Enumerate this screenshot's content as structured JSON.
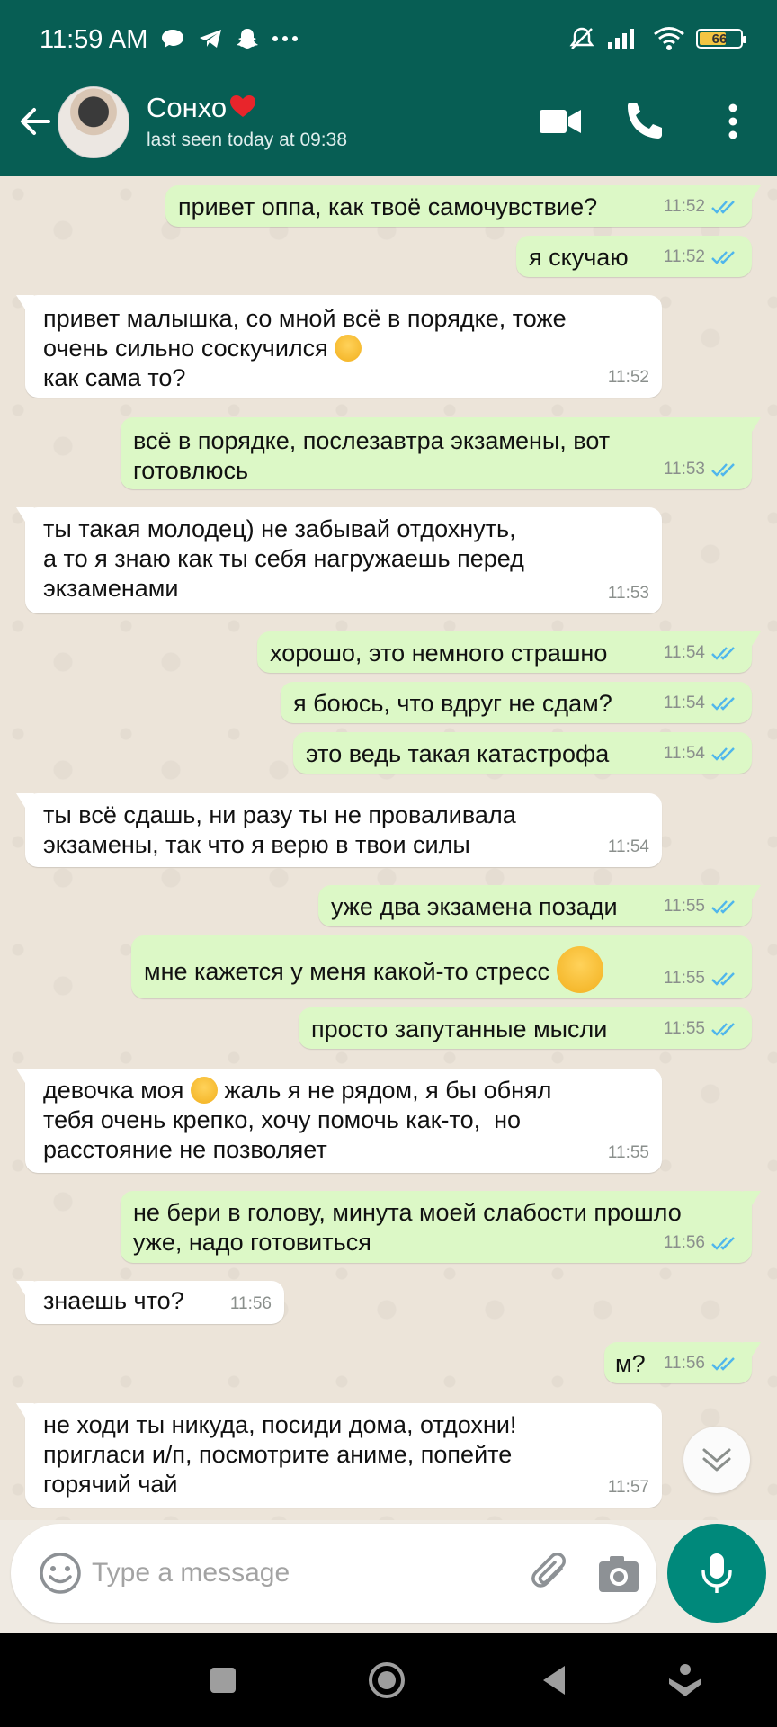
{
  "status_bar": {
    "time": "11:59 AM",
    "battery": "66",
    "icons": [
      "chat-bubble-icon",
      "telegram-icon",
      "snapchat-icon",
      "more-dots-icon",
      "muted-bell-icon",
      "signal-icon",
      "wifi-icon",
      "battery-icon"
    ]
  },
  "header": {
    "name": "Сонхо",
    "status": "last seen today at 09:38",
    "color": "#075e54"
  },
  "messages": [
    {
      "dir": "out",
      "text": "привет оппа, как твоё самочувствие?",
      "time": "11:52"
    },
    {
      "dir": "out",
      "text": "я скучаю",
      "time": "11:52"
    },
    {
      "dir": "in",
      "text": "привет малышка, со мной всё в порядке, тоже\nочень сильно соскучился",
      "text2": "как сама то?",
      "time": "11:52"
    },
    {
      "dir": "out",
      "text": "всё в порядке, послезавтра экзамены, вот\nготовлюсь",
      "time": "11:53"
    },
    {
      "dir": "in",
      "text": "ты такая молодец) не забывай отдохнуть,\nа то я знаю как ты себя нагружаешь перед\nэкзаменами",
      "time": "11:53"
    },
    {
      "dir": "out",
      "text": "хорошо, это немного страшно",
      "time": "11:54"
    },
    {
      "dir": "out",
      "text": "я боюсь, что вдруг не сдам?",
      "time": "11:54"
    },
    {
      "dir": "out",
      "text": "это ведь такая катастрофа",
      "time": "11:54"
    },
    {
      "dir": "in",
      "text": "ты всё сдашь, ни разу ты не проваливала\nэкзамены, так что я верю в твои силы",
      "time": "11:54"
    },
    {
      "dir": "out",
      "text": "уже два экзамена позади",
      "time": "11:55"
    },
    {
      "dir": "out",
      "text": "мне кажется у меня какой-то стресс",
      "time": "11:55"
    },
    {
      "dir": "out",
      "text": "просто запутанные мысли",
      "time": "11:55"
    },
    {
      "dir": "in",
      "text": "девочка моя",
      "text2": "жаль я не рядом, я бы обнял\nтебя очень крепко, хочу помочь как-то,  но\nрасстояние не позволяет",
      "time": "11:55"
    },
    {
      "dir": "out",
      "text": "не бери в голову, минута моей слабости прошло\nуже, надо готовиться",
      "time": "11:56"
    },
    {
      "dir": "in",
      "text": "знаешь что?",
      "time": "11:56"
    },
    {
      "dir": "out",
      "text": "м?",
      "time": "11:56"
    },
    {
      "dir": "in",
      "text": "не ходи ты никуда, посиди дома, отдохни!\nпригласи и/п, посмотрите аниме, попейте\nгорячий чай",
      "time": "11:57"
    }
  ],
  "input": {
    "placeholder": "Type a message"
  },
  "colors": {
    "outgoing_bubble": "#dcf8c6",
    "incoming_bubble": "#ffffff",
    "read_ticks": "#4fb6ec",
    "mic_button": "#00897b"
  }
}
